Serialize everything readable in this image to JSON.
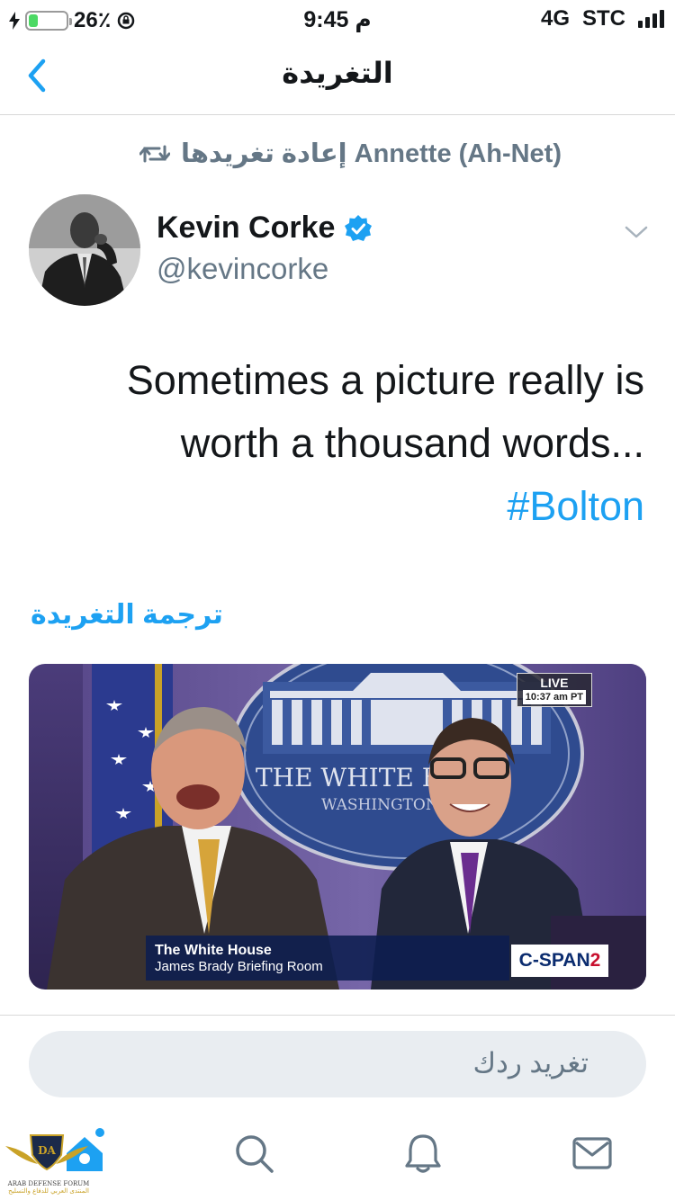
{
  "status_bar": {
    "battery_percent": "26٪",
    "battery_level": 0.26,
    "time": "9:45 م",
    "network": "4G",
    "carrier": "STC"
  },
  "header": {
    "title": "التغريدة",
    "back_icon": "chevron-left-icon"
  },
  "retweet": {
    "text": "Annette (Ah-Net) إعادة تغريدها",
    "icon": "retweet-icon"
  },
  "author": {
    "name": "Kevin Corke",
    "handle": "@kevincorke",
    "verified": true
  },
  "tweet": {
    "text_line1": "Sometimes a picture really is",
    "text_line2": "worth a thousand words...",
    "hashtag": "#Bolton",
    "translate_label": "ترجمة التغريدة"
  },
  "media": {
    "live_label": "LIVE",
    "live_time": "10:37 am PT",
    "backdrop_text": "THE WHITE H",
    "backdrop_subtext": "WASHINGTON",
    "lower_third_line1": "The White House",
    "lower_third_line2": "James Brady Briefing Room",
    "network_logo": "C-SPAN",
    "network_logo_num": "2"
  },
  "reply": {
    "placeholder": "تغريد ردك"
  },
  "tab_bar": {
    "items": [
      "home-icon",
      "search-icon",
      "bell-icon",
      "mail-icon"
    ],
    "watermark": "ARAB DEFENSE FORUM",
    "watermark_sub": "المنتدى العربي للدفاع والتسليح",
    "watermark_mark": "DA"
  },
  "colors": {
    "accent": "#1da1f2",
    "secondary_text": "#657786",
    "battery": "#4cd964"
  }
}
